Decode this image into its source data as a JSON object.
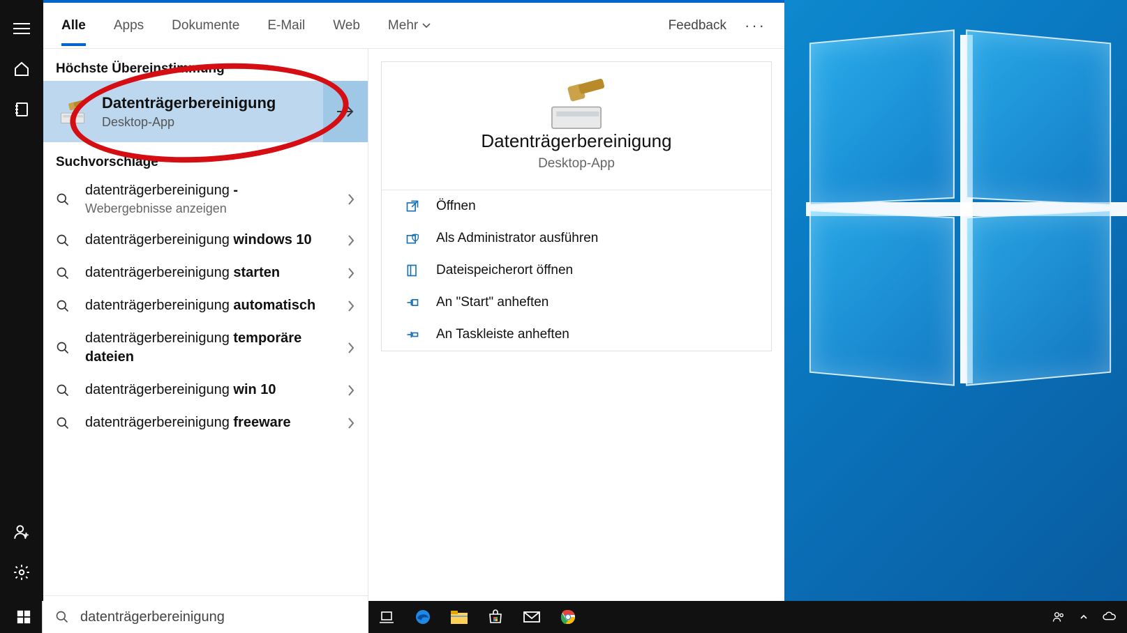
{
  "tabs": {
    "alle": "Alle",
    "apps": "Apps",
    "dokumente": "Dokumente",
    "email": "E-Mail",
    "web": "Web",
    "mehr": "Mehr"
  },
  "feedback": "Feedback",
  "sections": {
    "top_match": "Höchste Übereinstimmung",
    "suggestions": "Suchvorschläge"
  },
  "top_match": {
    "title": "Datenträgerbereinigung",
    "subtitle": "Desktop-App"
  },
  "suggestions": [
    {
      "prefix": "datenträgerbereinigung",
      "suffix": " - ",
      "subline": "Webergebnisse anzeigen"
    },
    {
      "prefix": "datenträgerbereinigung ",
      "suffix": "windows 10"
    },
    {
      "prefix": "datenträgerbereinigung ",
      "suffix": "starten"
    },
    {
      "prefix": "datenträgerbereinigung ",
      "suffix": "automatisch"
    },
    {
      "prefix": "datenträgerbereinigung ",
      "suffix": "temporäre dateien"
    },
    {
      "prefix": "datenträgerbereinigung ",
      "suffix": "win 10"
    },
    {
      "prefix": "datenträgerbereinigung ",
      "suffix": "freeware"
    }
  ],
  "preview": {
    "title": "Datenträgerbereinigung",
    "subtitle": "Desktop-App",
    "actions": {
      "open": "Öffnen",
      "admin": "Als Administrator ausführen",
      "file_loc": "Dateispeicherort öffnen",
      "pin_start": "An \"Start\" anheften",
      "pin_task": "An Taskleiste anheften"
    }
  },
  "search_input": "datenträgerbereinigung"
}
